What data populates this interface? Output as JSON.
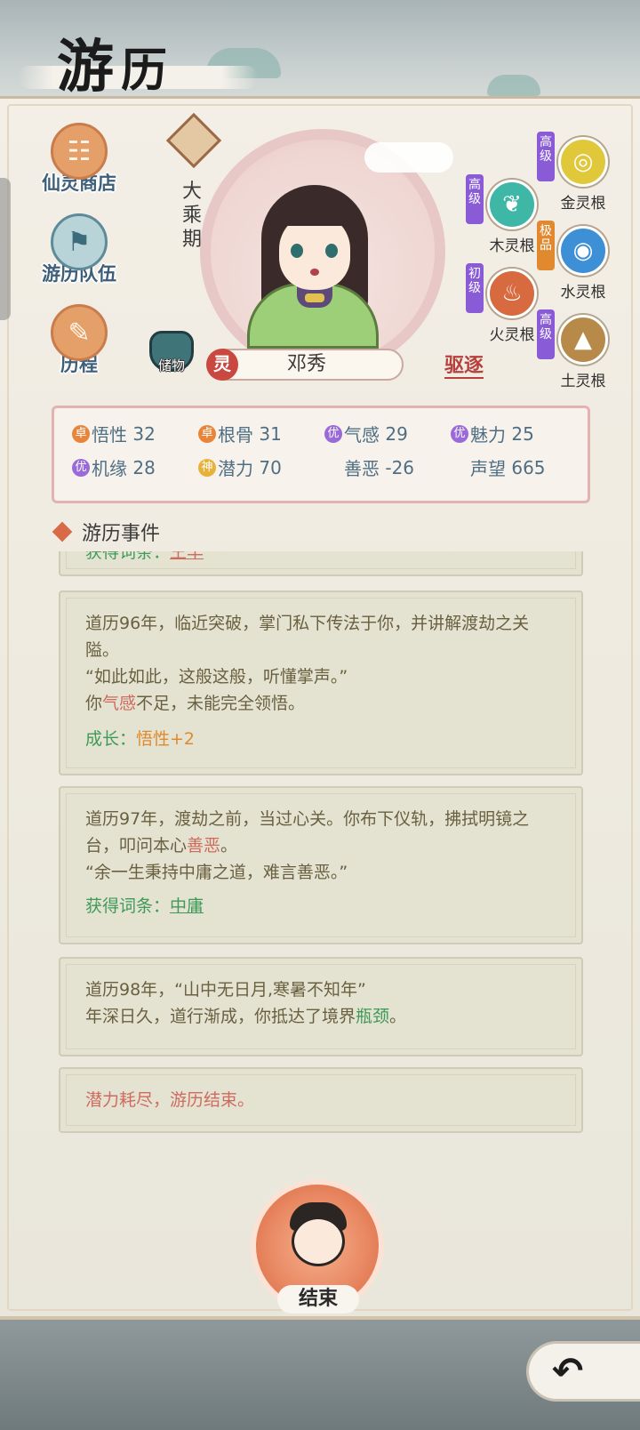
{
  "title": {
    "char1": "游",
    "char2": "历"
  },
  "side_buttons": [
    {
      "label": "仙灵商店",
      "glyph": "☷"
    },
    {
      "label": "游历队伍",
      "glyph": "⚑"
    },
    {
      "label": "历程",
      "glyph": "✎"
    }
  ],
  "character": {
    "realm": "大乘期",
    "spirit_tag": "灵",
    "name": "邓秀",
    "storage_label": "储物",
    "expel_label": "驱逐"
  },
  "spirit_roots": [
    {
      "grade": "高级",
      "label": "金灵根",
      "grade_color": "#8a5bd6",
      "orb_color": "#e0c83a",
      "glyph": "◎"
    },
    {
      "grade": "高级",
      "label": "木灵根",
      "grade_color": "#8a5bd6",
      "orb_color": "#3fb7a6",
      "glyph": "❦"
    },
    {
      "grade": "极品",
      "label": "水灵根",
      "grade_color": "#e0892f",
      "orb_color": "#3d8fd6",
      "glyph": "◉"
    },
    {
      "grade": "初级",
      "label": "火灵根",
      "grade_color": "#8a5bd6",
      "orb_color": "#d86a3f",
      "glyph": "♨"
    },
    {
      "grade": "高级",
      "label": "土灵根",
      "grade_color": "#8a5bd6",
      "orb_color": "#b88a4a",
      "glyph": "▲"
    }
  ],
  "stats": [
    {
      "badge": "卓",
      "badge_color": "#e8853a",
      "label": "悟性",
      "value": "32"
    },
    {
      "badge": "卓",
      "badge_color": "#e8853a",
      "label": "根骨",
      "value": "31"
    },
    {
      "badge": "优",
      "badge_color": "#9a6ad8",
      "label": "气感",
      "value": "29"
    },
    {
      "badge": "优",
      "badge_color": "#9a6ad8",
      "label": "魅力",
      "value": "25"
    },
    {
      "badge": "优",
      "badge_color": "#9a6ad8",
      "label": "机缘",
      "value": "28"
    },
    {
      "badge": "神",
      "badge_color": "#e8b23a",
      "label": "潜力",
      "value": "70"
    },
    {
      "badge": "",
      "badge_color": "",
      "label": "善恶",
      "value": "-26"
    },
    {
      "badge": "",
      "badge_color": "",
      "label": "声望",
      "value": "665"
    }
  ],
  "section_title": "游历事件",
  "events": {
    "partial": {
      "label": "获得词条：",
      "tag": "王羊"
    },
    "e96": {
      "line1": "道历96年，临近突破，掌门私下传法于你，并讲解渡劫之关隘。",
      "line2": "“如此如此，这般这般，听懂掌声。”",
      "line3a": "你",
      "line3b": "气感",
      "line3c": "不足，未能完全领悟。",
      "growth_label": "成长：",
      "growth_value": "悟性+2"
    },
    "e97": {
      "line1a": "道历97年，渡劫之前，当过心关。你布下仪轨，拂拭明镜之台，叩问本心",
      "line1b": "善恶",
      "line1c": "。",
      "line2": "“余一生秉持中庸之道，难言善恶。”",
      "gain_label": "获得词条：",
      "gain_value": "中庸"
    },
    "e98": {
      "line1": "道历98年，“山中无日月,寒暑不知年”",
      "line2a": "年深日久，道行渐成，你抵达了境界",
      "line2b": "瓶颈",
      "line2c": "。"
    },
    "end": {
      "text": "潜力耗尽，游历结束。"
    }
  },
  "end_button": {
    "label": "结束"
  },
  "back_button": {
    "glyph": "↶"
  }
}
